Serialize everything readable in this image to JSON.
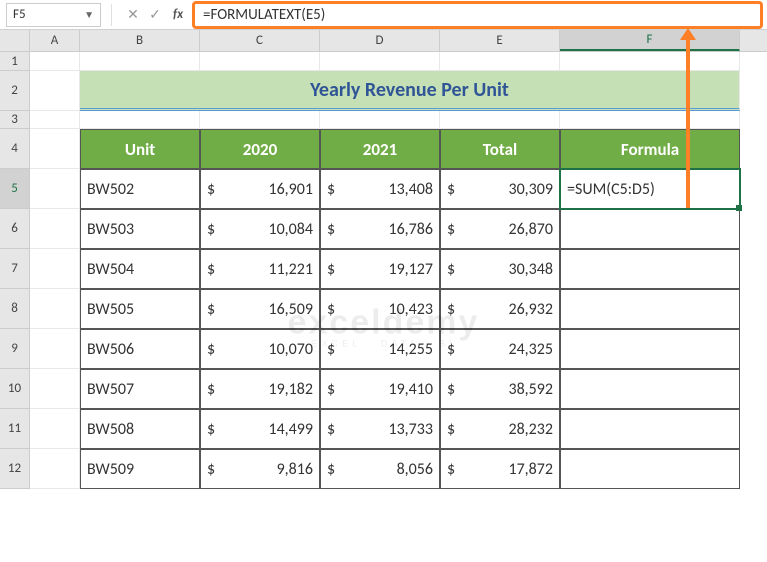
{
  "name_box": "F5",
  "fx_label": "fx",
  "formula_input": "=FORMULATEXT(E5)",
  "columns": [
    "A",
    "B",
    "C",
    "D",
    "E",
    "F"
  ],
  "rows": [
    "1",
    "2",
    "3",
    "4",
    "5",
    "6",
    "7",
    "8",
    "9",
    "10",
    "11",
    "12"
  ],
  "title": "Yearly Revenue Per Unit",
  "headers": {
    "unit": "Unit",
    "y2020": "2020",
    "y2021": "2021",
    "total": "Total",
    "formula": "Formula"
  },
  "data": [
    {
      "unit": "BW502",
      "y2020": "16,901",
      "y2021": "13,408",
      "total": "30,309",
      "formula": "=SUM(C5:D5)"
    },
    {
      "unit": "BW503",
      "y2020": "10,084",
      "y2021": "16,786",
      "total": "26,870",
      "formula": ""
    },
    {
      "unit": "BW504",
      "y2020": "11,221",
      "y2021": "19,127",
      "total": "30,348",
      "formula": ""
    },
    {
      "unit": "BW505",
      "y2020": "16,509",
      "y2021": "10,423",
      "total": "26,932",
      "formula": ""
    },
    {
      "unit": "BW506",
      "y2020": "10,070",
      "y2021": "14,255",
      "total": "24,325",
      "formula": ""
    },
    {
      "unit": "BW507",
      "y2020": "19,182",
      "y2021": "19,410",
      "total": "38,592",
      "formula": ""
    },
    {
      "unit": "BW508",
      "y2020": "14,499",
      "y2021": "13,733",
      "total": "28,232",
      "formula": ""
    },
    {
      "unit": "BW509",
      "y2020": "9,816",
      "y2021": "8,056",
      "total": "17,872",
      "formula": ""
    }
  ],
  "currency": "$",
  "watermark": {
    "big": "exceldemy",
    "small": "EXCEL · DATA · BI"
  },
  "colors": {
    "accent": "#70ad47",
    "title_bg": "#c5e0b4",
    "title_fg": "#2f5597",
    "highlight": "#ff7f27"
  }
}
